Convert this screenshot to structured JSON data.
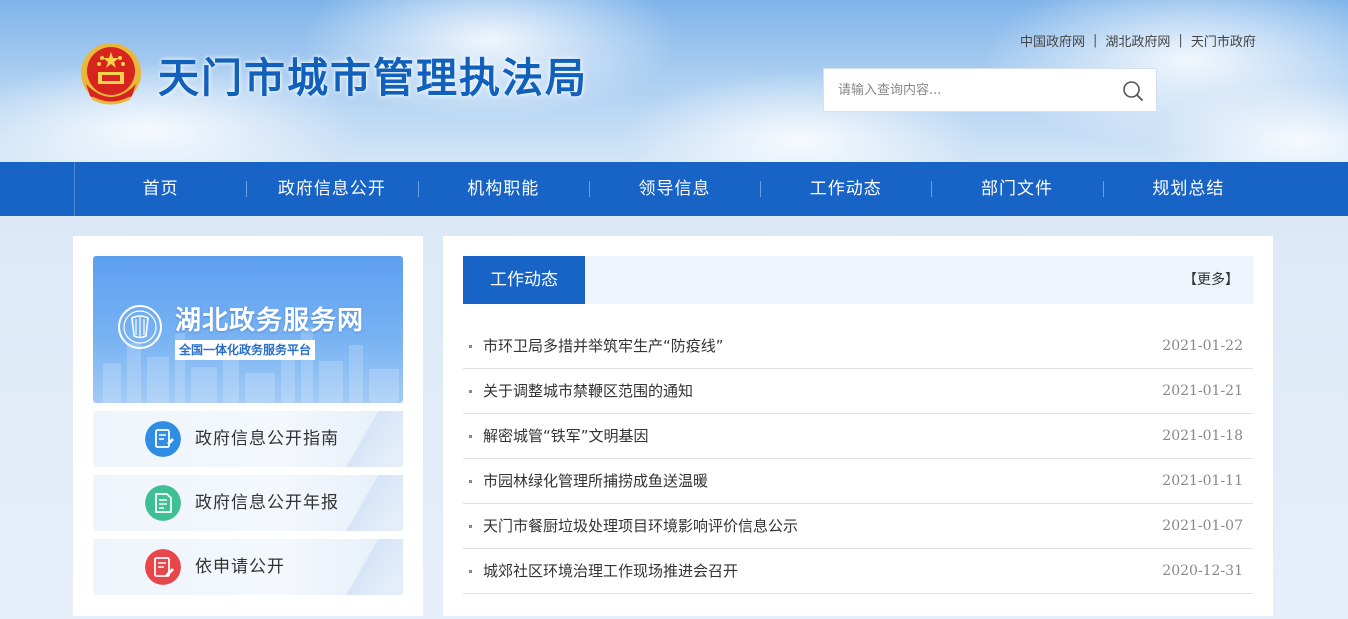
{
  "header": {
    "site_title": "天门市城市管理执法局",
    "top_links": [
      "中国政府网",
      "湖北政府网",
      "天门市政府"
    ],
    "search": {
      "placeholder": "请输入查询内容..."
    }
  },
  "nav": {
    "items": [
      "首页",
      "政府信息公开",
      "机构职能",
      "领导信息",
      "工作动态",
      "部门文件",
      "规划总结"
    ]
  },
  "sidebar": {
    "banner": {
      "title": "湖北政务服务网",
      "subtitle": "全国一体化政务服务平台"
    },
    "quick_links": [
      {
        "label": "政府信息公开指南",
        "icon": "guide-icon",
        "color": "#2f8de4"
      },
      {
        "label": "政府信息公开年报",
        "icon": "report-icon",
        "color": "#3fbf94"
      },
      {
        "label": "依申请公开",
        "icon": "apply-icon",
        "color": "#e7474b"
      }
    ]
  },
  "news": {
    "tab_label": "工作动态",
    "more_label": "【更多】",
    "items": [
      {
        "title": "市环卫局多措并举筑牢生产“防疫线”",
        "date": "2021-01-22"
      },
      {
        "title": "关于调整城市禁鞭区范围的通知",
        "date": "2021-01-21"
      },
      {
        "title": "解密城管“铁军”文明基因",
        "date": "2021-01-18"
      },
      {
        "title": "市园林绿化管理所捕捞成鱼送温暖",
        "date": "2021-01-11"
      },
      {
        "title": "天门市餐厨垃圾处理项目环境影响评价信息公示",
        "date": "2021-01-07"
      },
      {
        "title": "城郊社区环境治理工作现场推进会召开",
        "date": "2020-12-31"
      }
    ]
  },
  "colors": {
    "primary": "#1763c6",
    "title_blue": "#1160bb"
  }
}
